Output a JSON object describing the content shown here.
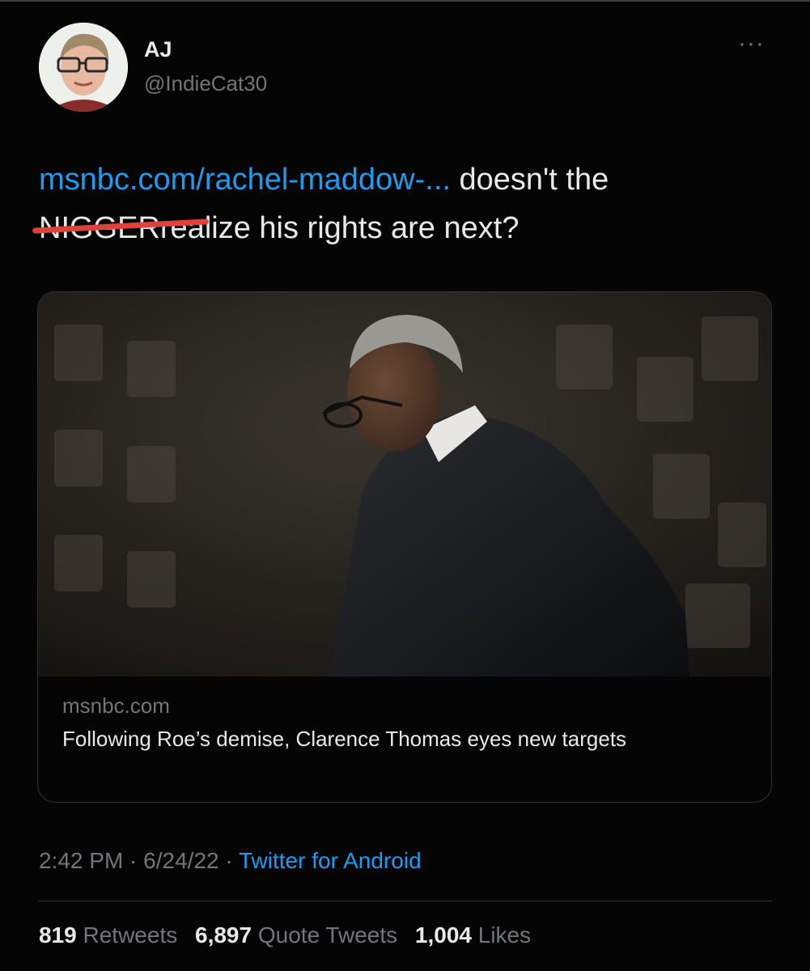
{
  "tweet": {
    "author": {
      "name": "AJ",
      "handle": "@IndieCat30"
    },
    "more_icon": "more-horizontal-icon",
    "text": {
      "link": "msnbc.com/rachel-maddow-...",
      "part1": " doesn't the ",
      "redacted_word": "NIGGER",
      "part2": "realize his rights are next?"
    },
    "card": {
      "domain": "msnbc.com",
      "title": "Following Roe’s demise, Clarence Thomas eyes new targets"
    },
    "meta": {
      "time": "2:42 PM",
      "sep1": " · ",
      "date": "6/24/22",
      "sep2": " · ",
      "source": "Twitter for Android"
    },
    "stats": {
      "retweets_count": "819",
      "retweets_label": "Retweets",
      "quotes_count": "6,897",
      "quotes_label": "Quote Tweets",
      "likes_count": "1,004",
      "likes_label": "Likes"
    }
  },
  "colors": {
    "background": "#050505",
    "link": "#1d9bf0",
    "secondary": "#71767b",
    "redaction": "#e0423b"
  }
}
